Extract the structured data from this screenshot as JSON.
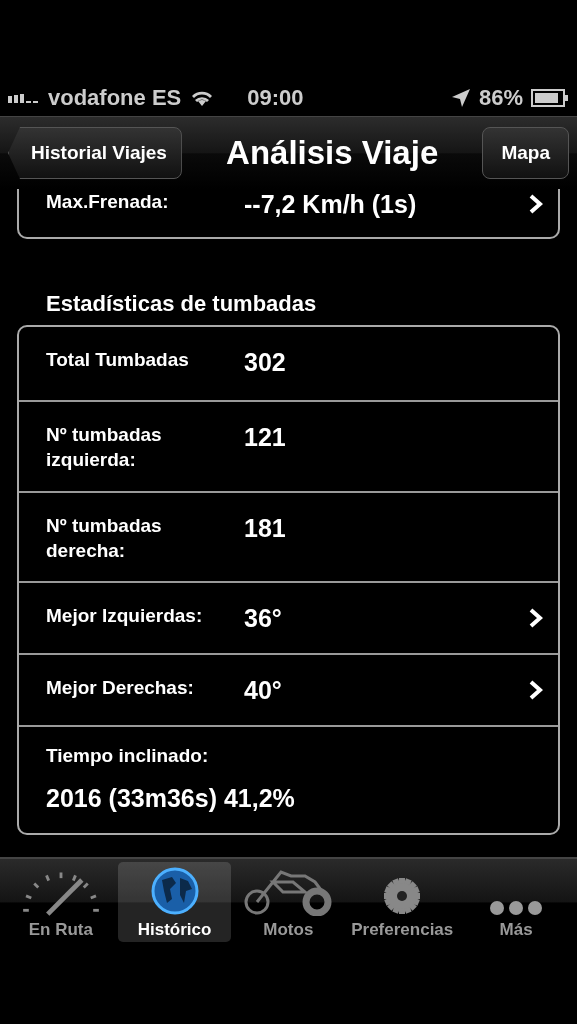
{
  "status_bar": {
    "carrier": "vodafone ES",
    "time": "09:00",
    "battery": "86%"
  },
  "nav_bar": {
    "back": "Historial Viajes",
    "title": "Análisis Viaje",
    "action": "Mapa"
  },
  "partial_row": {
    "label": "Max.Frenada:",
    "value": "--7,2 Km/h (1s)",
    "disclosure": true
  },
  "section": {
    "title": "Estadísticas de tumbadas",
    "rows": [
      {
        "kind": "inline",
        "label": "Total Tumbadas",
        "value": "302",
        "disclosure": false
      },
      {
        "kind": "inline",
        "label": "Nº tumbadas izquierda:",
        "value": "121",
        "disclosure": false
      },
      {
        "kind": "inline",
        "label": "Nº tumbadas derecha:",
        "value": "181",
        "disclosure": false
      },
      {
        "kind": "inline",
        "label": "Mejor Izquierdas:",
        "value": "36°",
        "disclosure": true
      },
      {
        "kind": "inline",
        "label": "Mejor Derechas:",
        "value": "40°",
        "disclosure": true
      },
      {
        "kind": "stacked",
        "label": "Tiempo inclinado:",
        "value": "2016 (33m36s) 41,2%",
        "disclosure": false
      }
    ]
  },
  "tab_bar": [
    {
      "kind": "gauge",
      "label": "En Ruta",
      "selected": false
    },
    {
      "kind": "globe",
      "label": "Histórico",
      "selected": true
    },
    {
      "kind": "motorbike",
      "label": "Motos",
      "selected": false
    },
    {
      "kind": "gear",
      "label": "Preferencias",
      "selected": false
    },
    {
      "kind": "more",
      "label": "Más",
      "selected": false
    }
  ]
}
